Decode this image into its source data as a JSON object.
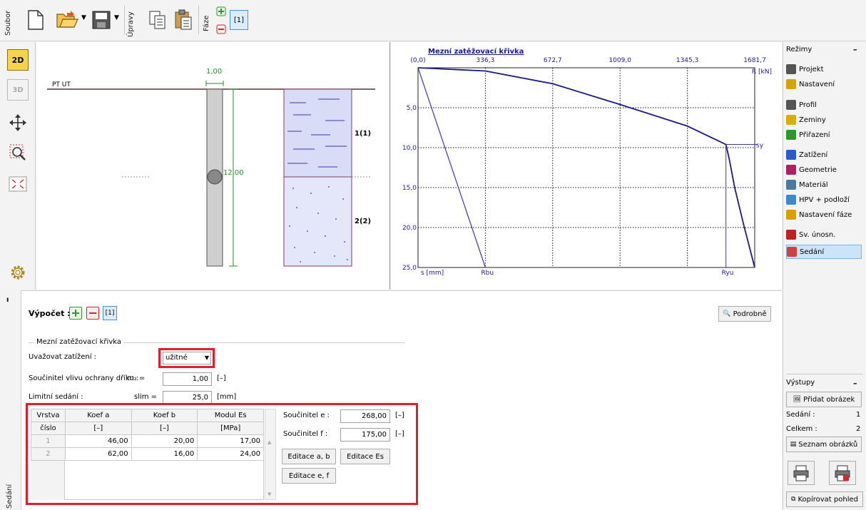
{
  "toolbar": {
    "group_file": "Soubor",
    "group_edit": "Úpravy",
    "group_phase": "Fáze",
    "phase_tab": "[1]"
  },
  "left_tools": {
    "view2d": "2D",
    "view3d": "3D"
  },
  "drawing": {
    "terrain_label": "PT UT",
    "diameter_label": "1,00",
    "length_label": "12,00",
    "layer1_label": "1(1)",
    "layer2_label": "2(2)"
  },
  "chart_data": {
    "type": "line",
    "title": "Mezní zatěžovací křivka",
    "xlabel": "R [kN]",
    "ylabel": "s [mm]",
    "x_ticks": [
      "(0,0)",
      "336,3",
      "672,7",
      "1009,0",
      "1345,3",
      "1681,7"
    ],
    "y_ticks": [
      "5,0",
      "10,0",
      "15,0",
      "20,0",
      "25,0"
    ],
    "xlim": [
      0,
      1681.7
    ],
    "ylim": [
      0,
      25.0
    ],
    "x_axis_position": "top",
    "y_inverted": true,
    "grid": true,
    "series": [
      {
        "x": [
          0,
          336.3,
          672.7,
          1009.0,
          1345.3,
          1538,
          1555,
          1581.7,
          1625,
          1681.7
        ],
        "y": [
          0,
          0.4,
          2.0,
          4.6,
          7.3,
          9.6,
          11.5,
          15.0,
          19.5,
          25.0
        ],
        "color": "#1a1a8c"
      },
      {
        "x": [
          0,
          336.3
        ],
        "y": [
          0,
          25.0
        ],
        "color": "#3a3aa0"
      }
    ],
    "markers": [
      {
        "label": "Rbu",
        "x": 336.3,
        "y": 25.0
      },
      {
        "label": "Ryu",
        "x": 1538,
        "y": 25.0
      },
      {
        "label": "sy",
        "x": 1681.7,
        "y": 9.6
      }
    ]
  },
  "right_panel": {
    "modes_title": "Režimy",
    "modes": [
      {
        "label": "Projekt",
        "icon": "project-icon"
      },
      {
        "label": "Nastavení",
        "icon": "settings-sun-icon"
      },
      {
        "label": "Profil",
        "icon": "profile-icon"
      },
      {
        "label": "Zeminy",
        "icon": "soils-icon"
      },
      {
        "label": "Přiřazení",
        "icon": "assign-icon"
      },
      {
        "label": "Zatížení",
        "icon": "load-icon"
      },
      {
        "label": "Geometrie",
        "icon": "geometry-icon"
      },
      {
        "label": "Materiál",
        "icon": "material-icon"
      },
      {
        "label": "HPV + podloží",
        "icon": "gwt-icon"
      },
      {
        "label": "Nastavení fáze",
        "icon": "stage-settings-icon"
      },
      {
        "label": "Sv. únosn.",
        "icon": "vertical-capacity-icon"
      },
      {
        "label": "Sedání",
        "icon": "settlement-icon"
      }
    ],
    "outputs_title": "Výstupy",
    "add_image": "Přidat obrázek",
    "settlement_label": "Sedání :",
    "settlement_count": "1",
    "total_label": "Celkem :",
    "total_count": "2",
    "image_list": "Seznam obrázků",
    "copy_view": "Kopírovat pohled"
  },
  "bottom": {
    "side_tab": "Sedání",
    "calc_label": "Výpočet :",
    "calc_tab": "[1]",
    "details_button": "Podrobně",
    "section_title": "Mezní zatěžovací křivka",
    "load_label": "Uvažovat zatížení :",
    "load_value": "užitné",
    "coef_label": "Součinitel vlivu ochrany dříku :",
    "coef_symbol": "m₂ =",
    "coef_value": "1,00",
    "coef_unit": "[–]",
    "limit_label": "Limitní sedání :",
    "limit_symbol": "slim =",
    "limit_value": "25,0",
    "limit_unit": "[mm]",
    "table": {
      "headers": [
        [
          "Vrstva",
          "číslo"
        ],
        [
          "Koef a",
          "[–]"
        ],
        [
          "Koef b",
          "[–]"
        ],
        [
          "Modul Es",
          "[MPa]"
        ]
      ],
      "rows": [
        {
          "num": "1",
          "a": "46,00",
          "b": "20,00",
          "es": "17,00"
        },
        {
          "num": "2",
          "a": "62,00",
          "b": "16,00",
          "es": "24,00"
        }
      ]
    },
    "coef_e_label": "Součinitel e :",
    "coef_e_value": "268,00",
    "coef_e_unit": "[–]",
    "coef_f_label": "Součinitel f :",
    "coef_f_value": "175,00",
    "coef_f_unit": "[–]",
    "edit_ab": "Editace a, b",
    "edit_es": "Editace Es",
    "edit_ef": "Editace e, f"
  }
}
